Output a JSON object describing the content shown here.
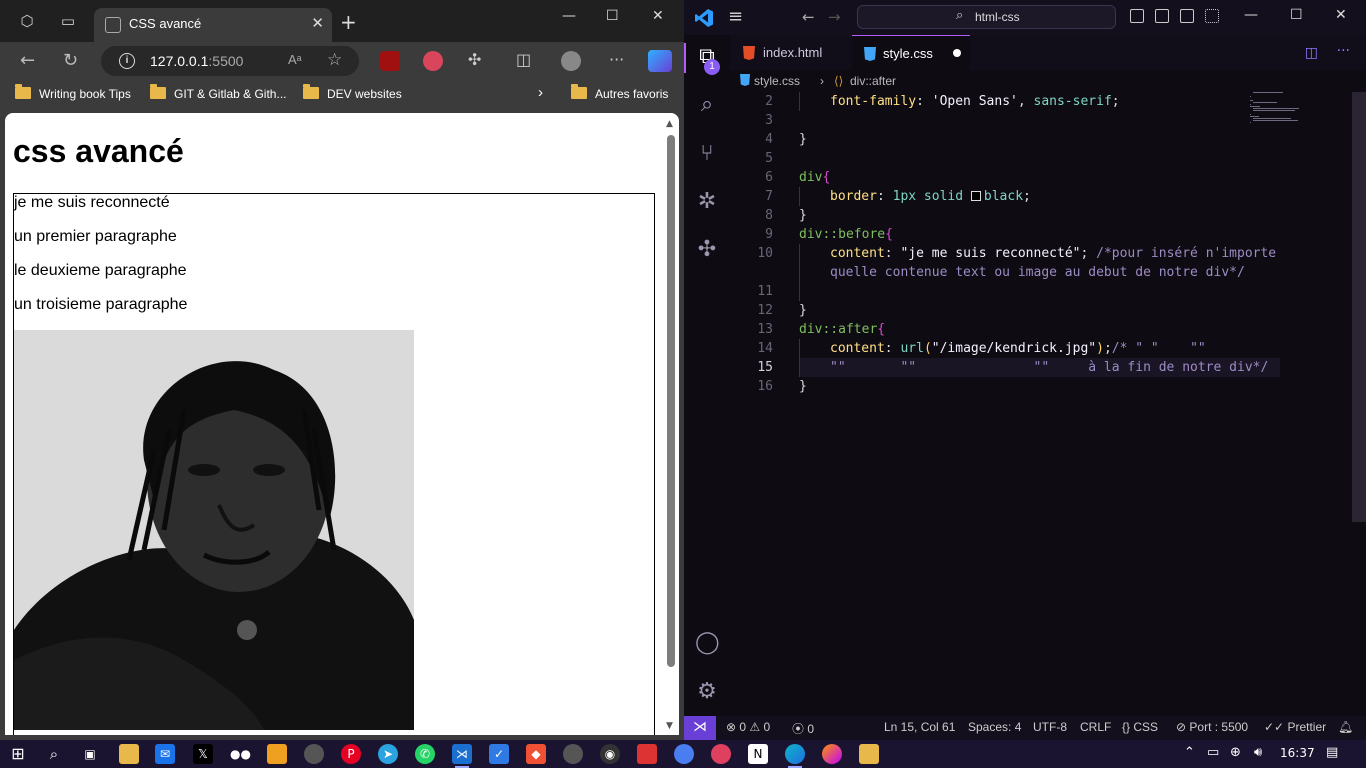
{
  "browser": {
    "tab_title": "CSS avancé",
    "url_host": "127.0.0.1",
    "url_port": ":5500",
    "read_aloud": "Aᵃ",
    "bookmarks": [
      "Writing book Tips",
      "GIT & Gitlab & Gith...",
      "DEV websites"
    ],
    "other_bookmarks": "Autres favoris",
    "page": {
      "heading": "css avancé",
      "before_text": "je me suis reconnecté",
      "paragraphs": [
        "un premier paragraphe",
        "le deuxieme paragraphe",
        "un troisieme paragraphe"
      ]
    }
  },
  "vscode": {
    "search": "html-css",
    "tabs": [
      {
        "label": "index.html",
        "type": "html"
      },
      {
        "label": "style.css",
        "type": "css",
        "active": true,
        "dirty": true
      }
    ],
    "explorer_badge": "1",
    "breadcrumb": {
      "file": "style.css",
      "symbol": "div::after"
    },
    "lines": [
      {
        "n": "2",
        "parts": [
          [
            "font-family",
            "prop"
          ],
          [
            ": ",
            "pun"
          ],
          [
            "'Open Sans'",
            "strw"
          ],
          [
            ", ",
            "pun"
          ],
          [
            "sans-serif",
            "val"
          ],
          [
            ";",
            "pun"
          ]
        ],
        "indent": 1
      },
      {
        "n": "3",
        "parts": [],
        "indent": 0
      },
      {
        "n": "4",
        "parts": [
          [
            "}",
            "pun"
          ]
        ],
        "indent": 0
      },
      {
        "n": "5",
        "parts": [],
        "indent": 0
      },
      {
        "n": "6",
        "parts": [
          [
            "div",
            "sel"
          ],
          [
            "{",
            "brace"
          ]
        ],
        "indent": 0
      },
      {
        "n": "7",
        "parts": [
          [
            "border",
            "prop"
          ],
          [
            ": ",
            "pun"
          ],
          [
            "1px",
            "num"
          ],
          [
            " solid ",
            "val"
          ],
          [
            "SWATCH",
            "swatch"
          ],
          [
            "black",
            "val"
          ],
          [
            ";",
            "pun"
          ]
        ],
        "indent": 1
      },
      {
        "n": "8",
        "parts": [
          [
            "}",
            "pun"
          ]
        ],
        "indent": 0
      },
      {
        "n": "9",
        "parts": [
          [
            "div::before",
            "sel"
          ],
          [
            "{",
            "brace"
          ]
        ],
        "indent": 0
      },
      {
        "n": "10",
        "parts": [
          [
            "content",
            "prop"
          ],
          [
            ": ",
            "pun"
          ],
          [
            "\"je me suis reconnecté\"",
            "strw"
          ],
          [
            "; ",
            "pun"
          ],
          [
            "/*pour inséré n'importe",
            "cmt"
          ]
        ],
        "indent": 1
      },
      {
        "n": "",
        "parts": [
          [
            "quelle contenue text ou image au debut de notre div*/",
            "cmt"
          ]
        ],
        "indent": 1
      },
      {
        "n": "11",
        "parts": [],
        "indent": 0
      },
      {
        "n": "12",
        "parts": [
          [
            "}",
            "pun"
          ]
        ],
        "indent": 0
      },
      {
        "n": "13",
        "parts": [
          [
            "div::after",
            "sel"
          ],
          [
            "{",
            "brace"
          ]
        ],
        "indent": 0
      },
      {
        "n": "14",
        "parts": [
          [
            "content",
            "prop"
          ],
          [
            ": ",
            "pun"
          ],
          [
            "url",
            "val"
          ],
          [
            "(",
            "str"
          ],
          [
            "\"/image/kendrick.jpg\"",
            "strw"
          ],
          [
            ")",
            "str"
          ],
          [
            ";",
            "pun"
          ],
          [
            "/* \" \"    \"\"",
            "cmt"
          ]
        ],
        "indent": 1
      },
      {
        "n": "15",
        "parts": [
          [
            "\"\"       \"\"               \"\"     à la fin de notre div*/",
            "cmt"
          ]
        ],
        "indent": 1,
        "current": true
      },
      {
        "n": "16",
        "parts": [
          [
            "}",
            "pun"
          ]
        ],
        "indent": 0
      }
    ],
    "status": {
      "errors": "0",
      "warnings": "0",
      "ports": "0",
      "position": "Ln 15, Col 61",
      "spaces": "Spaces: 4",
      "encoding": "UTF-8",
      "eol": "CRLF",
      "language": "CSS",
      "port": "Port : 5500",
      "prettier": "Prettier"
    }
  },
  "taskbar": {
    "time": "16:37"
  }
}
